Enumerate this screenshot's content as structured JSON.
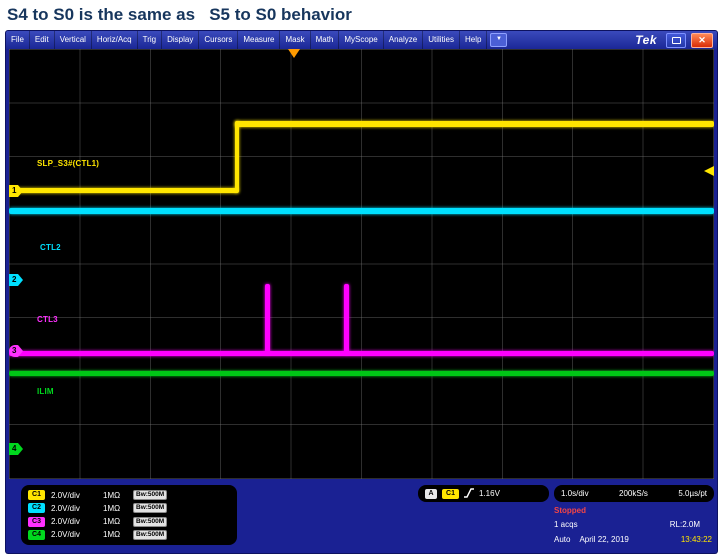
{
  "title": "S4 to S0 is the same as   S5 to S0 behavior",
  "window": {
    "logo": "Tek"
  },
  "icons": {
    "close": "✕",
    "dropdown": "▼"
  },
  "menu": {
    "items": [
      "File",
      "Edit",
      "Vertical",
      "Horiz/Acq",
      "Trig",
      "Display",
      "Cursors",
      "Measure",
      "Mask",
      "Math",
      "MyScope",
      "Analyze",
      "Utilities",
      "Help"
    ]
  },
  "colors": {
    "ch1": "#ffe600",
    "ch2": "#00e0ff",
    "ch3": "#ff00ff",
    "ch4": "#00c816",
    "panel": "#1a2193",
    "status_stopped": "#f34545"
  },
  "channels": [
    {
      "id": "C1",
      "marker": "1",
      "label": "SLP_S3#(CTL1)",
      "scale": "2.0V/div",
      "coupling": "1MΩ",
      "bandwidth": "Bw:500M"
    },
    {
      "id": "C2",
      "marker": "2",
      "label": "CTL2",
      "scale": "2.0V/div",
      "coupling": "1MΩ",
      "bandwidth": "Bw:500M"
    },
    {
      "id": "C3",
      "marker": "3",
      "label": "CTL3",
      "scale": "2.0V/div",
      "coupling": "1MΩ",
      "bandwidth": "Bw:500M"
    },
    {
      "id": "C4",
      "marker": "4",
      "label": "ILIM",
      "scale": "2.0V/div",
      "coupling": "1MΩ",
      "bandwidth": "Bw:500M"
    }
  ],
  "trigger": {
    "bus": "A",
    "source": "C1",
    "level": "1.16V"
  },
  "timebase": {
    "scale": "1.0s/div",
    "rate": "200kS/s",
    "resolution": "5.0µs/pt"
  },
  "acquisition": {
    "status": "Stopped",
    "count": "1 acqs",
    "record_length": "RL:2.0M",
    "mode": "Auto",
    "date": "April 22, 2019",
    "time": "13:43:22"
  }
}
